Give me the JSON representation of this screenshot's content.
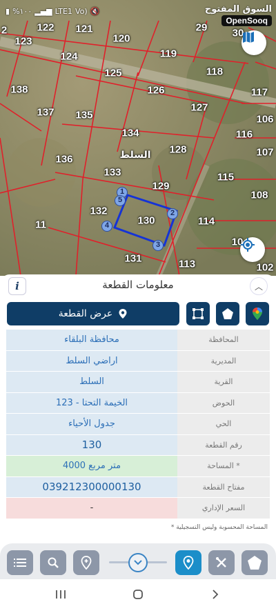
{
  "status": {
    "battery": "%١٠٠",
    "network": "LTE1",
    "wifi_label": "Vo)",
    "brand_ar": "السوق المفتوح",
    "brand_en": "OpenSooq"
  },
  "map": {
    "town_name": "السلط",
    "plots": [
      "2",
      "122",
      "121",
      "120",
      "29",
      "30",
      "123",
      "124",
      "119",
      "125",
      "118",
      "138",
      "126",
      "117",
      "137",
      "135",
      "127",
      "106",
      "134",
      "116",
      "136",
      "128",
      "107",
      "133",
      "115",
      "129",
      "108",
      "132",
      "130",
      "114",
      "11",
      "10",
      "131",
      "113",
      "102"
    ],
    "corners": [
      "1",
      "5",
      "2",
      "4",
      "3"
    ],
    "buttons": {
      "layers": "layers-icon",
      "locate": "locate-icon"
    }
  },
  "panel": {
    "title": "معلومات القطعة",
    "show_plot_label": "عرض القطعة",
    "rows": [
      {
        "key": "المحافظة",
        "value": "محافظة البلقاء"
      },
      {
        "key": "المديرية",
        "value": "اراضي السلط"
      },
      {
        "key": "القرية",
        "value": "السلط"
      },
      {
        "key": "الحوض",
        "value": "الخيمة التحتا - 123"
      },
      {
        "key": "الحي",
        "value": "جدول الأحياء"
      },
      {
        "key": "رقم القطعة",
        "value": "130"
      },
      {
        "key": "المساحة *",
        "value": "4000  متر مربع"
      },
      {
        "key": "مفتاح القطعة",
        "value": "039212300000130"
      },
      {
        "key": "السعر الإداري",
        "value": "-"
      }
    ],
    "note": "* المساحة المحسوبة وليس التسجيلية"
  },
  "colors": {
    "primary": "#0f3d66",
    "accent": "#1b8ec9",
    "value_text": "#2c6fb7",
    "row_blue": "#dde9f3",
    "row_green": "#d7efd7",
    "row_pink": "#f7dcdc"
  }
}
